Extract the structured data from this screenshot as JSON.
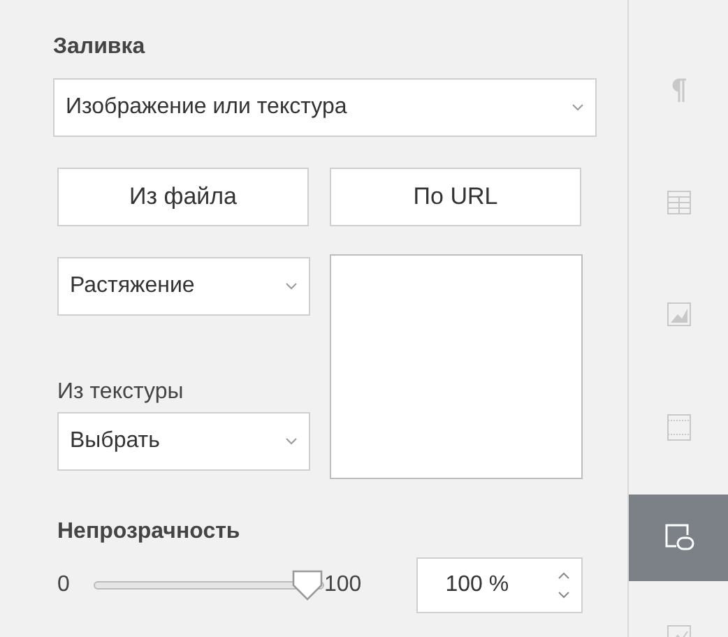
{
  "fill": {
    "title": "Заливка",
    "fill_type": {
      "value": "Изображение или текстура"
    },
    "buttons": [
      "Из файла",
      "По URL"
    ],
    "stretch": {
      "value": "Растяжение"
    },
    "texture_label": "Из текстуры",
    "texture": {
      "value": "Выбрать"
    }
  },
  "opacity": {
    "title": "Непрозрачность",
    "min": "0",
    "max": "100",
    "level": 1,
    "value": "100 %"
  },
  "sidebar": {
    "tabs": [
      {
        "kind": "paragraph",
        "selected": false
      },
      {
        "kind": "table",
        "selected": false
      },
      {
        "kind": "image",
        "selected": false
      },
      {
        "kind": "header",
        "selected": false
      },
      {
        "kind": "shape",
        "selected": true
      },
      {
        "kind": "chart",
        "selected": false
      }
    ]
  }
}
